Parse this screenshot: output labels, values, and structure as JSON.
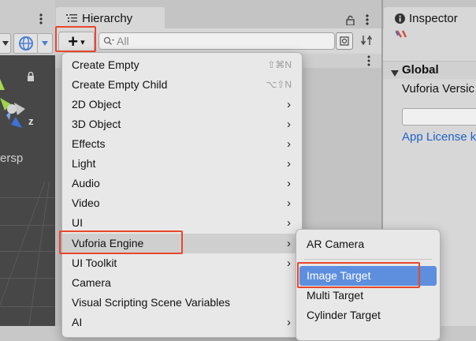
{
  "hierarchy": {
    "tab_label": "Hierarchy",
    "search_placeholder": "All",
    "add_button_label": "+",
    "add_button_arrow": "▾"
  },
  "scene": {
    "persp_label": "ersp",
    "gizmo_z_label": "z"
  },
  "inspector": {
    "tab_label": "Inspector",
    "section_title": "Global",
    "vuforia_version_label": "Vuforia Versic",
    "app_license_link": "App License k"
  },
  "create_menu": {
    "items": [
      {
        "label": "Create Empty",
        "shortcut": "⇧⌘N"
      },
      {
        "label": "Create Empty Child",
        "shortcut": "⌥⇧N"
      },
      {
        "label": "2D Object",
        "arrow": "›"
      },
      {
        "label": "3D Object",
        "arrow": "›"
      },
      {
        "label": "Effects",
        "arrow": "›"
      },
      {
        "label": "Light",
        "arrow": "›"
      },
      {
        "label": "Audio",
        "arrow": "›"
      },
      {
        "label": "Video",
        "arrow": "›"
      },
      {
        "label": "UI",
        "arrow": "›"
      },
      {
        "label": "Vuforia Engine",
        "arrow": "›"
      },
      {
        "label": "UI Toolkit",
        "arrow": "›"
      },
      {
        "label": "Camera"
      },
      {
        "label": "Visual Scripting Scene Variables"
      },
      {
        "label": "AI",
        "arrow": "›"
      }
    ]
  },
  "vuforia_submenu": {
    "items": [
      {
        "label": "AR Camera"
      },
      {
        "label": "Image Target"
      },
      {
        "label": "Multi Target"
      },
      {
        "label": "Cylinder Target"
      }
    ]
  },
  "colors": {
    "highlight_outline": "#e8472b",
    "selection_blue": "#5d8fde",
    "link_blue": "#1f63c6",
    "scene_bg": "#474747"
  }
}
